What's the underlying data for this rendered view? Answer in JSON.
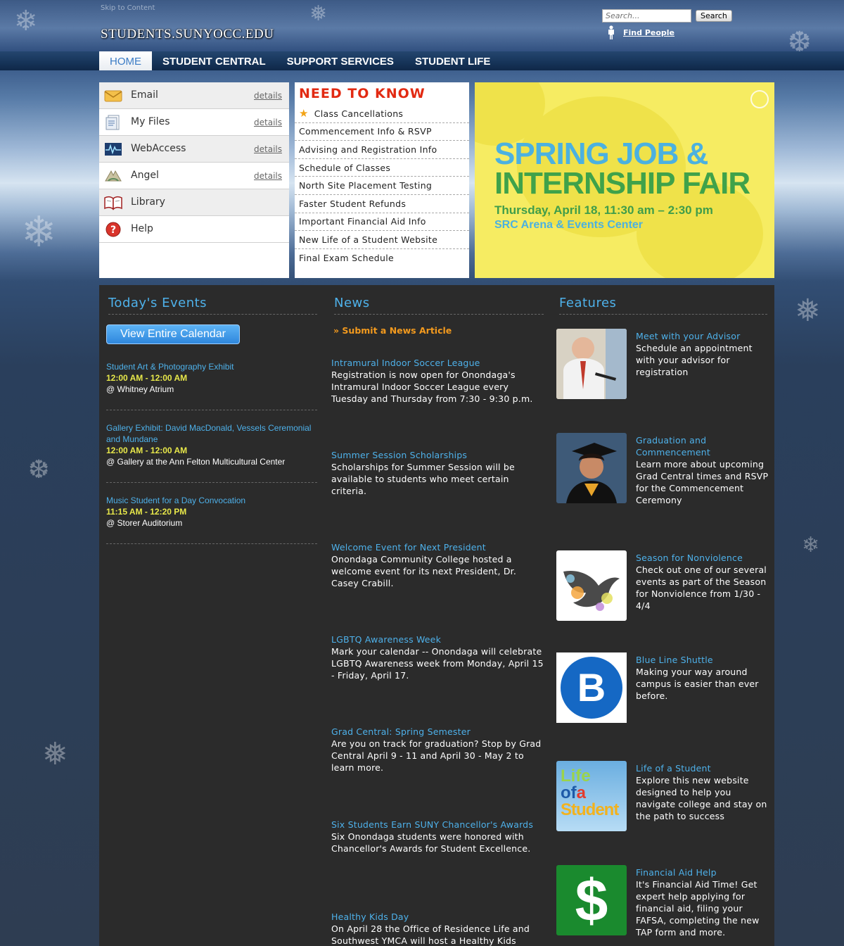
{
  "header": {
    "skip_link": "Skip to Content",
    "site_name": "STUDENTS.SUNYOCC.EDU",
    "search_placeholder": "Search...",
    "search_button": "Search",
    "find_people": "Find People"
  },
  "nav": {
    "items": [
      {
        "label": "HOME"
      },
      {
        "label": "STUDENT CENTRAL"
      },
      {
        "label": "SUPPORT SERVICES"
      },
      {
        "label": "STUDENT LIFE"
      }
    ]
  },
  "quick_links": [
    {
      "label": "Email",
      "details": "details",
      "icon": "envelope-icon"
    },
    {
      "label": "My Files",
      "details": "details",
      "icon": "files-icon"
    },
    {
      "label": "WebAccess",
      "details": "details",
      "icon": "pulse-icon"
    },
    {
      "label": "Angel",
      "details": "details",
      "icon": "angel-icon"
    },
    {
      "label": "Library",
      "icon": "book-icon"
    },
    {
      "label": "Help",
      "icon": "help-icon"
    }
  ],
  "need_to_know": {
    "title": "NEED TO KNOW",
    "items": [
      "Class Cancellations",
      "Commencement Info & RSVP",
      "Advising and Registration Info",
      "Schedule of Classes",
      "North Site Placement Testing",
      "Faster Student Refunds",
      "Important Financial Aid Info",
      "New Life of a Student Website",
      "Final Exam Schedule"
    ]
  },
  "banner": {
    "line1": "SPRING JOB &",
    "line2": "INTERNSHIP FAIR",
    "line3": "Thursday, April 18, 11:30 am – 2:30 pm",
    "line4": "SRC Arena & Events Center"
  },
  "events": {
    "heading": "Today's Events",
    "calendar_button": "View Entire Calendar",
    "items": [
      {
        "title": "Student Art & Photography Exhibit",
        "time": "12:00 AM - 12:00 AM",
        "location": "@ Whitney Atrium"
      },
      {
        "title": "Gallery Exhibit: David MacDonald, Vessels Ceremonial and Mundane",
        "time": "12:00 AM - 12:00 AM",
        "location": "@ Gallery at the Ann Felton Multicultural Center"
      },
      {
        "title": "Music Student for a Day Convocation",
        "time": "11:15 AM - 12:20 PM",
        "location": "@ Storer Auditorium"
      }
    ]
  },
  "news": {
    "heading": "News",
    "submit_link": "» Submit a News Article",
    "items": [
      {
        "title": "Intramural Indoor Soccer League",
        "desc": "Registration is now open for Onondaga's Intramural Indoor Soccer League every Tuesday and Thursday from 7:30 - 9:30 p.m."
      },
      {
        "title": "Summer Session Scholarships",
        "desc": "Scholarships for Summer Session will be available to students who meet certain criteria."
      },
      {
        "title": "Welcome Event for Next President",
        "desc": "Onondaga Community College hosted a welcome event for its next President, Dr. Casey Crabill."
      },
      {
        "title": "LGBTQ Awareness Week",
        "desc": "Mark your calendar -- Onondaga will celebrate LGBTQ Awareness week from Monday, April 15 - Friday, April 17."
      },
      {
        "title": "Grad Central: Spring Semester",
        "desc": "Are you on track for graduation? Stop by Grad Central April 9 - 11 and April 30 - May 2 to learn more."
      },
      {
        "title": "Six Students Earn SUNY Chancellor's Awards",
        "desc": "Six Onondaga students were honored with Chancellor's Awards for Student Excellence."
      },
      {
        "title": "Healthy Kids Day",
        "desc": "On April 28 the Office of Residence Life and Southwest YMCA will host a Healthy Kids"
      }
    ]
  },
  "features": {
    "heading": "Features",
    "items": [
      {
        "title": "Meet with your Advisor",
        "desc": "Schedule an appointment with your advisor for registration"
      },
      {
        "title": "Graduation and Commencement",
        "desc": "Learn more about upcoming Grad Central times and RSVP for the Commencement Ceremony"
      },
      {
        "title": "Season for Nonviolence",
        "desc": "Check out one of our several events as part of the Season for Nonviolence from 1/30 - 4/4"
      },
      {
        "title": "Blue Line Shuttle",
        "desc": "Making your way around campus is easier than ever before."
      },
      {
        "title": "Life of a Student",
        "desc": "Explore this new website designed to help you navigate college and stay on the path to success"
      },
      {
        "title": "Financial Aid Help",
        "desc": "It's Financial Aid Time! Get expert help applying for financial aid, filing your FAFSA, completing the new TAP form and more."
      }
    ],
    "images": {
      "shuttle_letter": "B",
      "life_line1": "Life",
      "life_line2a": "of",
      "life_line2b": "a",
      "life_line3": "Student",
      "dollar": "$"
    }
  },
  "colors": {
    "accent_blue": "#4eb1ea",
    "time_yellow": "#e8e84a",
    "need_to_know_red": "#e22a12",
    "submit_orange": "#f39a1e",
    "banner_yellow": "#f6ec62"
  }
}
